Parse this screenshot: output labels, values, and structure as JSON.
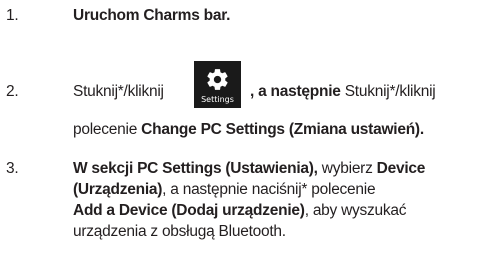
{
  "steps": [
    {
      "number": "1.",
      "lines": [
        [
          {
            "text": "Uruchom ",
            "bold": true
          },
          {
            "text": "Charms bar.",
            "bold": true
          }
        ]
      ]
    },
    {
      "number": "2.",
      "line1_before": "Stuknij*/kliknij",
      "tile": {
        "label": "Settings",
        "icon": "gear-icon"
      },
      "line1_after_bold": ", a następnie",
      "line1_after_regular": " Stuknij*/kliknij",
      "line2_regular": "polecenie ",
      "line2_bold": "Change PC Settings (Zmiana ustawień)."
    },
    {
      "number": "3.",
      "l1_a": "W sekcji ",
      "l1_b": "PC Settings (Ustawienia),",
      "l1_c": " wybierz ",
      "l1_d": "Device",
      "l2_a": "(Urządzenia)",
      "l2_b": ", a następnie naciśnij* polecenie",
      "l3_a": "Add a Device (Dodaj urządzenie)",
      "l3_b": ", aby wyszukać",
      "l4_a": "urządzenia z obsługą Bluetooth."
    }
  ]
}
